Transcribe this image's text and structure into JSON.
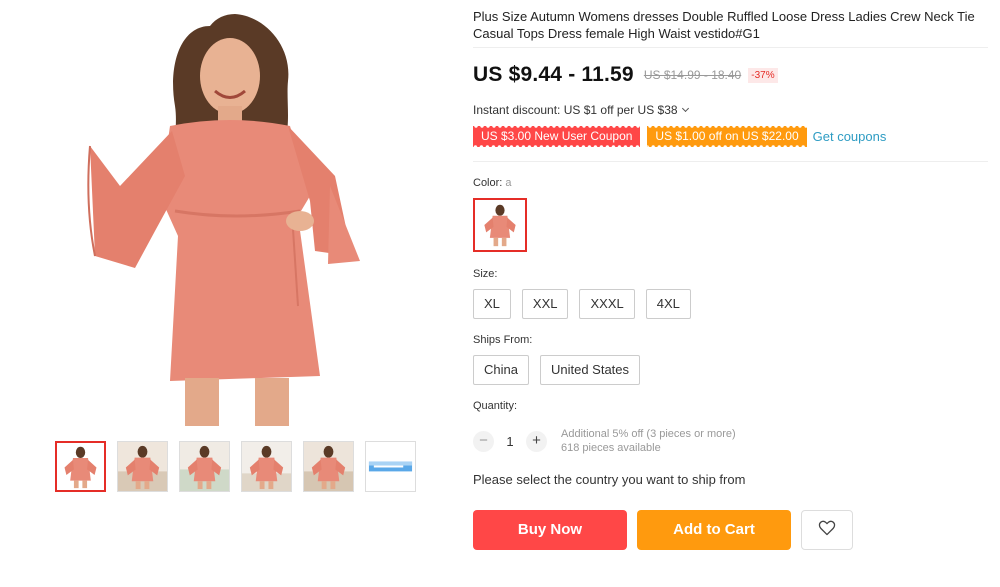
{
  "product": {
    "title": "Plus Size Autumn Womens dresses Double Ruffled Loose Dress Ladies Crew Neck Tie Casual Tops Dress female High Waist vestido#G1",
    "price": "US $9.44 - 11.59",
    "original_price": "US $14.99 - 18.40",
    "discount": "-37%"
  },
  "promo": {
    "instant_discount": "Instant discount: US $1 off per US $38",
    "coupons": [
      {
        "label": "US $3.00 New User Coupon",
        "color": "#ff4747"
      },
      {
        "label": "US $1.00 off on US $22.00",
        "color": "#ff9a0e"
      }
    ],
    "get_coupons": "Get coupons"
  },
  "color": {
    "label": "Color:",
    "selected": "a"
  },
  "size": {
    "label": "Size:",
    "options": [
      "XL",
      "XXL",
      "XXXL",
      "4XL"
    ]
  },
  "ships_from": {
    "label": "Ships From:",
    "options": [
      "China",
      "United States"
    ]
  },
  "quantity": {
    "label": "Quantity:",
    "minus": "−",
    "plus": "+",
    "value": "1",
    "additional": "Additional 5% off (3 pieces or more)",
    "available": "618 pieces available"
  },
  "ship_note": "Please select the country you want to ship from",
  "actions": {
    "buy_now": "Buy Now",
    "add_to_cart": "Add to Cart"
  },
  "gallery": {
    "thumbnail_count": 6,
    "active_index": 0
  },
  "colors": {
    "accent_red": "#ff4747",
    "accent_orange": "#ff9a0e",
    "link_blue": "#2e9cc3",
    "dress": "#e88a78"
  },
  "icons": {
    "wishlist": "heart-icon",
    "dropdown": "chevron-down-icon"
  }
}
